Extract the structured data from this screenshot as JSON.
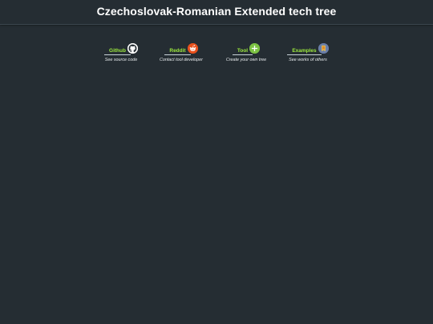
{
  "page": {
    "title": "Czechoslovak-Romanian Extended tech tree"
  },
  "links": [
    {
      "label": "Github",
      "subtitle": "See source code",
      "icon": "github-icon"
    },
    {
      "label": "Reddit",
      "subtitle": "Contact tool developer",
      "icon": "reddit-icon"
    },
    {
      "label": "Tool",
      "subtitle": "Create your own tree",
      "icon": "plus-icon"
    },
    {
      "label": "Examples",
      "subtitle": "See works of others",
      "icon": "bookmark-icon"
    }
  ],
  "colors": {
    "background": "#252d33",
    "title": "#ffffff",
    "link_label": "#9dea3e",
    "subtitle": "#e6eaec",
    "reddit": "#e8501c",
    "tool": "#7cc243",
    "examples": "#6a7ea8"
  }
}
